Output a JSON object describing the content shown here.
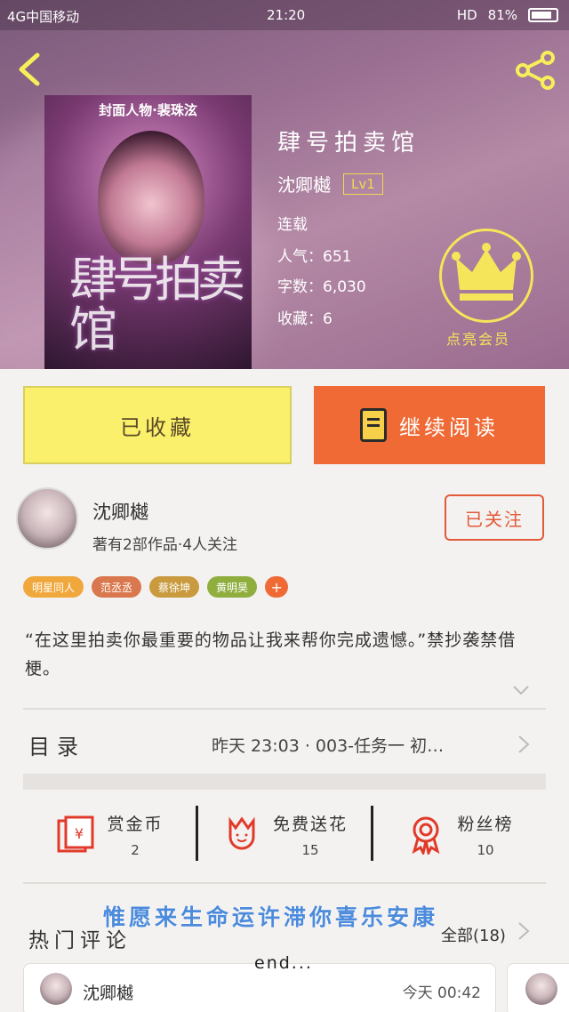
{
  "status_bar": {
    "carrier": "4G中国移动",
    "time": "21:20",
    "battery": "81%",
    "hd": "HD"
  },
  "book": {
    "title": "肆号拍卖馆",
    "author": "沈卿樾",
    "level": "Lv1",
    "status": "连载",
    "popularity": "人气：651",
    "word_count": "字数：6,030",
    "favorites": "收藏：6",
    "cover_top_text": "封面人物·裴珠泫",
    "cover_title": "肆号拍卖馆"
  },
  "vip": {
    "label": "点亮会员",
    "icon": "crown-icon"
  },
  "actions": {
    "collected": "已收藏",
    "continue_reading": "继续阅读"
  },
  "author_card": {
    "name": "沈卿樾",
    "works": "著有2部作品·4人关注",
    "follow": "已关注"
  },
  "tags": [
    {
      "label": "明星同人",
      "color": "#f0a83c"
    },
    {
      "label": "范丞丞",
      "color": "#d9784e"
    },
    {
      "label": "蔡徐坤",
      "color": "#c99a3e"
    },
    {
      "label": "黄明昊",
      "color": "#8fae3e"
    }
  ],
  "tag_add": "+",
  "description": "“在这里拍卖你最重要的物品让我来帮你完成遗憾。”禁抄袭禁借梗。",
  "catalog": {
    "label": "目录",
    "latest": "昨天 23:03 · 003-任务一 初…"
  },
  "stats": [
    {
      "label": "赏金币",
      "value": "2",
      "icon": "red-envelope-icon"
    },
    {
      "label": "免费送花",
      "value": "15",
      "icon": "flower-icon"
    },
    {
      "label": "粉丝榜",
      "value": "10",
      "icon": "medal-icon"
    }
  ],
  "overlay_text": "惟愿来生命运许滞你喜乐安康",
  "end_text": "end...",
  "hot_comments": {
    "label": "热门评论",
    "all": "全部(18)"
  },
  "comment": {
    "name": "沈卿樾",
    "time": "今天 00:42"
  },
  "colors": {
    "accent": "#ef6a35",
    "yellow": "#fbf06b",
    "vip": "#f5e55a"
  }
}
